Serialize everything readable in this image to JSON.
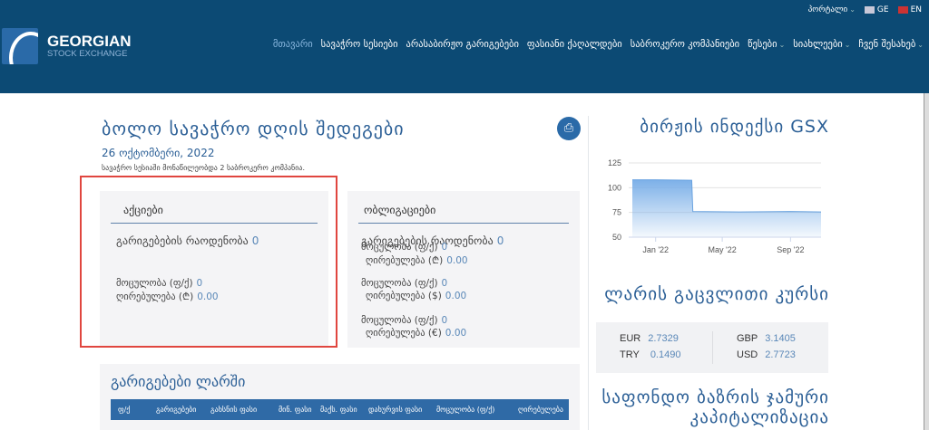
{
  "topbar": {
    "portal": "პორტალი",
    "lang_ge": "GE",
    "lang_en": "EN"
  },
  "logo": {
    "line1": "GEORGIAN",
    "line2": "STOCK EXCHANGE"
  },
  "nav": [
    {
      "label": "მთავარი",
      "active": true
    },
    {
      "label": "სავაჭრო სესიები"
    },
    {
      "label": "არასაბირჟო გარიგებები"
    },
    {
      "label": "ფასიანი ქაღალდები"
    },
    {
      "label": "საბროკერო კომპანიები"
    },
    {
      "label": "წესები",
      "dropdown": true
    },
    {
      "label": "სიახლეები",
      "dropdown": true
    },
    {
      "label": "ჩვენ შესახებ",
      "dropdown": true
    }
  ],
  "main": {
    "title": "ბოლო სავაჭრო დღის შედეგები",
    "date": "26 ოქტომბერი, 2022",
    "note": "სავაჭრო სესიაში მონაწილეობდა 2 საბროკერო კომპანია.",
    "shares": {
      "title": "აქციები",
      "count_label": "გარიგებების რაოდენობა",
      "count": "0",
      "volume_label": "მოცულობა (ფ/ქ)",
      "volume": "0",
      "value_label": "ღირებულება (₾)",
      "value": "0.00"
    },
    "bonds": {
      "title": "ობლიგაციები",
      "count_label": "გარიგებების რაოდენობა",
      "count": "0",
      "rows": [
        {
          "volume_label": "მოცულობა (ფ/ქ)",
          "volume": "0",
          "value_label": "ღირებულება (₾)",
          "value": "0.00"
        },
        {
          "volume_label": "მოცულობა (ფ/ქ)",
          "volume": "0",
          "value_label": "ღირებულება ($)",
          "value": "0.00"
        },
        {
          "volume_label": "მოცულობა (ფ/ქ)",
          "volume": "0",
          "value_label": "ღირებულება (€)",
          "value": "0.00"
        }
      ]
    },
    "deals": {
      "title": "გარიგებები ლარში",
      "columns": [
        "ფ/ქ",
        "გარიგებები",
        "გახსნის ფასი",
        "მინ. ფასი",
        "მაქს. ფასი",
        "დახურვის ფასი",
        "მოცულობა (ფ/ქ)",
        "ღირებულება"
      ]
    }
  },
  "sidebar": {
    "index_title": "ბირჟის ინდექსი GSX",
    "fx_title": "ლარის გაცვლითი კურსი",
    "fx": [
      {
        "code": "EUR",
        "rate": "2.7329"
      },
      {
        "code": "TRY",
        "rate": "0.1490"
      },
      {
        "code": "GBP",
        "rate": "3.1405"
      },
      {
        "code": "USD",
        "rate": "2.7723"
      }
    ],
    "cap_title_1": "საფონდო ბაზრის ჯამური",
    "cap_title_2": "კაპიტალიზაცია"
  },
  "chart_data": {
    "type": "area",
    "ylim": [
      50,
      125
    ],
    "yticks": [
      "125",
      "100",
      "75",
      "50"
    ],
    "xticks": [
      "Jan '22",
      "May '22",
      "Sep '22"
    ],
    "grid": true,
    "color": "#7cb0e8",
    "x": [
      "2021-11-20",
      "2022-01-01",
      "2022-03-07",
      "2022-03-09",
      "2022-06-01",
      "2022-09-01",
      "2022-10-26"
    ],
    "y": [
      108,
      108,
      107.5,
      76,
      75.5,
      76,
      75.5
    ]
  }
}
